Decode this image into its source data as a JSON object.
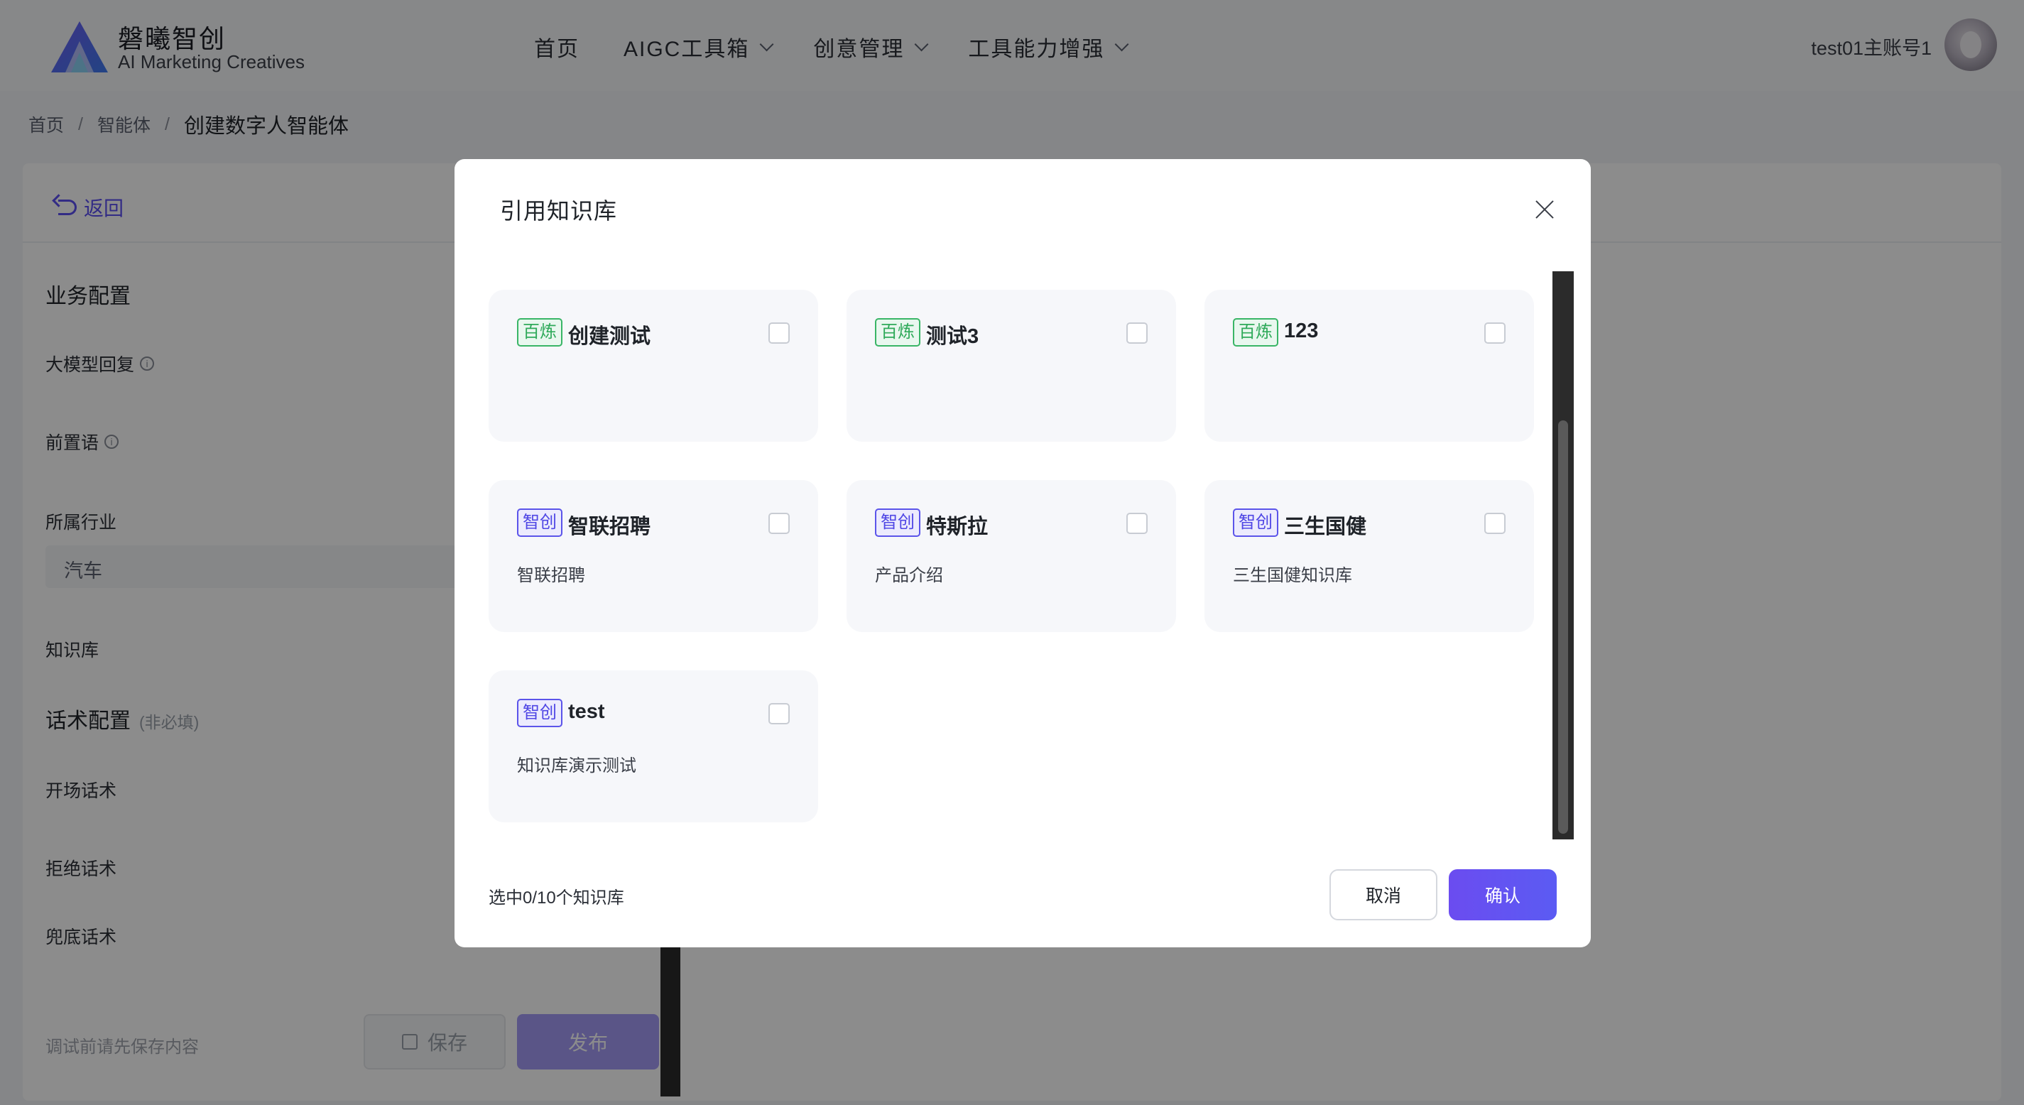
{
  "header": {
    "brand_cn": "磐曦智创",
    "brand_en": "AI Marketing Creatives",
    "nav": [
      {
        "label": "首页"
      },
      {
        "label": "AIGC工具箱"
      },
      {
        "label": "创意管理"
      },
      {
        "label": "工具能力增强"
      }
    ],
    "user_name": "test01主账号1"
  },
  "breadcrumb": {
    "items": [
      "首页",
      "智能体"
    ],
    "separator": "/",
    "current": "创建数字人智能体"
  },
  "page": {
    "back_label": "返回",
    "section_business": "业务配置",
    "llm_reply_label": "大模型回复",
    "preamble_label": "前置语",
    "industry_label": "所属行业",
    "industry_value": "汽车",
    "kb_label": "知识库",
    "section_script": "话术配置",
    "section_script_optional": "(非必填)",
    "opening_label": "开场话术",
    "reject_label": "拒绝话术",
    "fallback_label": "兜底话术",
    "debug_hint": "调试前请先保存内容",
    "save_label": "保存",
    "publish_label": "发布"
  },
  "modal": {
    "title": "引用知识库",
    "cards": [
      {
        "tag": "百炼",
        "tag_type": "bailian",
        "name": "创建测试",
        "desc": "",
        "checked": false
      },
      {
        "tag": "百炼",
        "tag_type": "bailian",
        "name": "测试3",
        "desc": "",
        "checked": false
      },
      {
        "tag": "百炼",
        "tag_type": "bailian",
        "name": "123",
        "desc": "",
        "checked": false
      },
      {
        "tag": "智创",
        "tag_type": "zhichuang",
        "name": "智联招聘",
        "desc": "智联招聘",
        "checked": false
      },
      {
        "tag": "智创",
        "tag_type": "zhichuang",
        "name": "特斯拉",
        "desc": "产品介绍",
        "checked": false
      },
      {
        "tag": "智创",
        "tag_type": "zhichuang",
        "name": "三生国健",
        "desc": "三生国健知识库",
        "checked": false
      },
      {
        "tag": "智创",
        "tag_type": "zhichuang",
        "name": "test",
        "desc": "知识库演示测试",
        "checked": false
      }
    ],
    "selection_text": "选中0/10个知识库",
    "cancel_label": "取消",
    "confirm_label": "确认"
  },
  "colors": {
    "accent": "#5b4ff2",
    "bailian_tag": "#2faa5a",
    "zhichuang_tag": "#4f46e5"
  },
  "icons": {
    "close": "close-icon",
    "back": "back-arrow-icon",
    "info": "info-icon",
    "dropdown": "chevron-down-icon",
    "save": "save-disk-icon"
  }
}
